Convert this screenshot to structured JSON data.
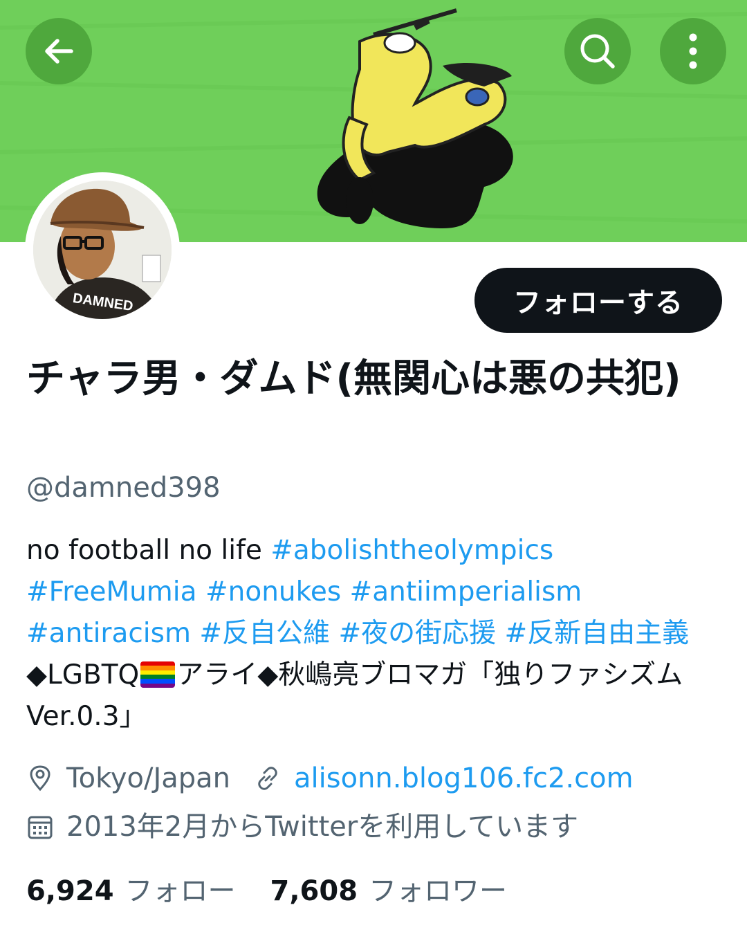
{
  "header": {
    "back_icon": "arrow-left-icon",
    "search_icon": "search-icon",
    "more_icon": "more-vertical-icon",
    "banner_color": "#6fcf5a",
    "button_color": "#4fa83d"
  },
  "avatar": {
    "badge_text": "DAMNED"
  },
  "actions": {
    "follow_label": "フォローする"
  },
  "profile": {
    "display_name": "チャラ男・ダムド(無関心は悪の共犯)",
    "handle": "@damned398",
    "bio": {
      "text1": "no football no life ",
      "tag1": "#abolishtheolympics",
      "tag2": "#FreeMumia",
      "tag3": "#nonukes",
      "tag4": "#antiimperialism",
      "tag5": "#antiracism",
      "tag6": "#反自公維",
      "tag7": "#夜の街応援",
      "tag8": "#反新自由主義",
      "text2": " ◆LGBTQ",
      "text3": "アライ◆秋嶋亮ブロマガ「独りファシズムVer.0.3」"
    },
    "location": "Tokyo/Japan",
    "website": "alisonn.blog106.fc2.com",
    "joined": "2013年2月からTwitterを利用しています",
    "link_color": "#1d9bf0"
  },
  "stats": {
    "following_count": "6,924",
    "following_label": "フォロー",
    "followers_count": "7,608",
    "followers_label": "フォロワー"
  }
}
